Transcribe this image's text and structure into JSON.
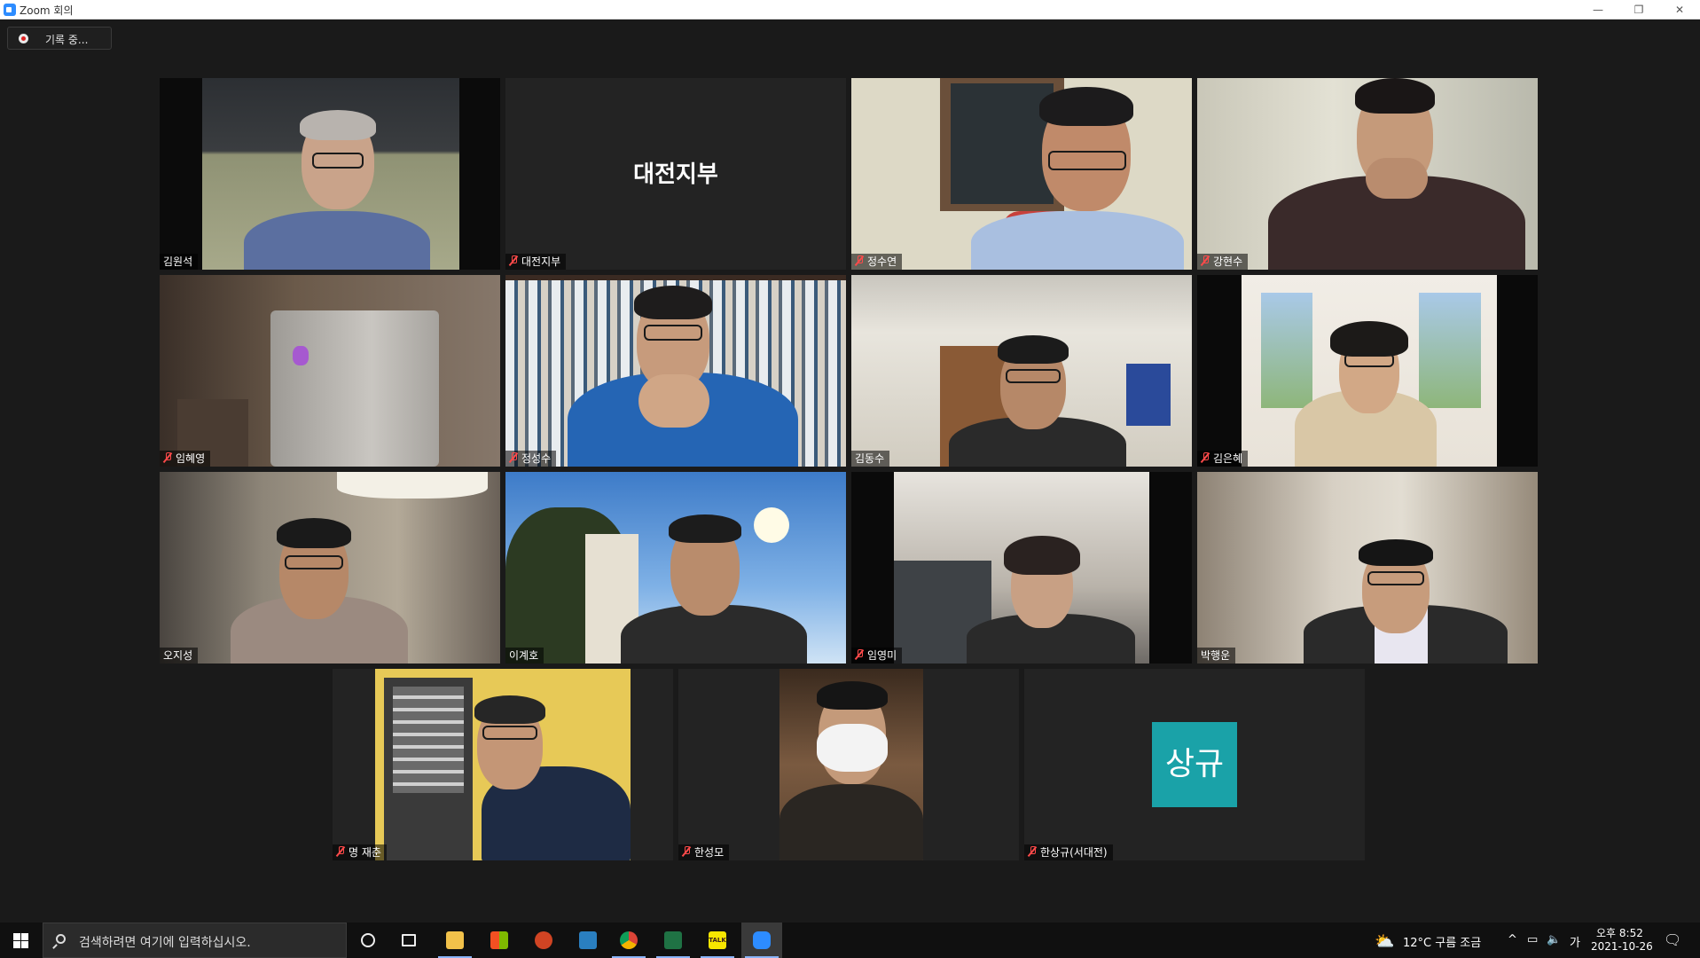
{
  "window": {
    "title": "Zoom 회의",
    "controls": {
      "minimize": "—",
      "restore": "❐",
      "close": "✕"
    }
  },
  "recording": {
    "label": "기록 중..."
  },
  "participants": [
    {
      "name": "김원석",
      "muted": false,
      "active": true
    },
    {
      "name": "대전지부",
      "muted": true,
      "display_name": "대전지부"
    },
    {
      "name": "정수연",
      "muted": true
    },
    {
      "name": "강현수",
      "muted": true
    },
    {
      "name": "임혜영",
      "muted": true
    },
    {
      "name": "정성수",
      "muted": true
    },
    {
      "name": "김동수",
      "muted": false
    },
    {
      "name": "김은혜",
      "muted": true
    },
    {
      "name": "오지성",
      "muted": false
    },
    {
      "name": "이계호",
      "muted": false
    },
    {
      "name": "임영미",
      "muted": true
    },
    {
      "name": "박행운",
      "muted": false
    },
    {
      "name": "명 재춘",
      "muted": true
    },
    {
      "name": "한성모",
      "muted": true
    },
    {
      "name": "한상규(서대전)",
      "muted": true,
      "avatar_text": "상규",
      "avatar_color": "#1aa2a8"
    }
  ],
  "taskbar": {
    "search_placeholder": "검색하려면 여기에 입력하십시오.",
    "apps": [
      "cortana-icon",
      "task-view-icon",
      "file-explorer-icon",
      "store-icon",
      "powerpoint-icon",
      "calculator-icon",
      "chrome-icon",
      "excel-icon",
      "kakaotalk-icon",
      "zoom-icon"
    ],
    "kakaotalk_label": "TALK",
    "weather": "12°C  구름 조금",
    "ime": "가",
    "time": "오후 8:52",
    "date": "2021-10-26"
  },
  "colors": {
    "active_speaker_border": "#d8e87a",
    "meeting_bg": "#1a1a1a",
    "muted_icon": "#ff4a4a",
    "avatar": "#1aa2a8"
  }
}
